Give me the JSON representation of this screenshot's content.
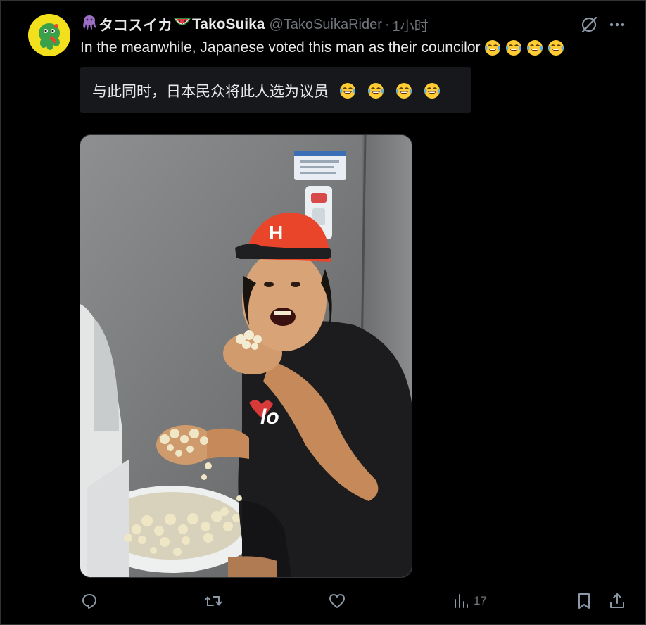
{
  "tweet": {
    "author": {
      "name_prefix_icon": "octopus-icon",
      "name_part1": "タコスイカ",
      "name_mid_icon": "watermelon-icon",
      "name_part2": "TakoSuika",
      "handle": "@TakoSuikaRider",
      "separator": "·",
      "time": "1小时"
    },
    "text": "In the meanwhile, Japanese voted this man as their councilor",
    "text_emojis": [
      "laughing-tears-icon",
      "laughing-tears-icon",
      "laughing-tears-icon",
      "laughing-tears-icon"
    ],
    "translation": {
      "text": "与此同时，日本民众将此人选为议员"
    },
    "media": {
      "type": "photo",
      "subject": "man-with-red-cap-eating-popcorn-photo"
    },
    "actions": {
      "reply_icon": "reply-icon",
      "retweet_icon": "retweet-icon",
      "like_icon": "heart-icon",
      "views_icon": "views-icon",
      "views_count": "17",
      "bookmark_icon": "bookmark-icon",
      "share_icon": "share-icon"
    }
  },
  "colors": {
    "background": "#000000",
    "text_primary": "#e7e9ea",
    "text_secondary": "#71767b",
    "translation_bg": "#16181c",
    "border": "#2f3336",
    "avatar_yellow": "#f2e01c",
    "avatar_green": "#3aa04a",
    "cap_red": "#e8452a"
  }
}
